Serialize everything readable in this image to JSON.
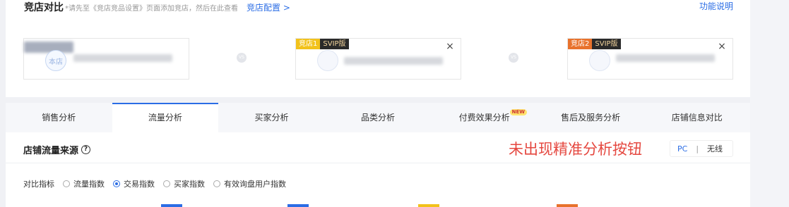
{
  "header": {
    "title": "竞店对比",
    "hint": "*请先至《竞店竞品设置》页面添加竞店，然后在此查看",
    "config_link": "竞店配置 >",
    "help_link": "功能说明"
  },
  "shops": [
    {
      "avatar_text": "本店"
    },
    {
      "badge": "竞店1",
      "badge_tier": "SVIP版",
      "badge_color": "#f2c21b",
      "close": "×"
    },
    {
      "badge": "竞店2",
      "badge_tier": "SVIP版",
      "badge_color": "#e8722c",
      "close": "×"
    }
  ],
  "vs_label": "VS",
  "tabs": [
    {
      "label": "销售分析"
    },
    {
      "label": "流量分析",
      "active": true
    },
    {
      "label": "买家分析"
    },
    {
      "label": "品类分析"
    },
    {
      "label": "付费效果分析",
      "tag": "NEW"
    },
    {
      "label": "售后及服务分析"
    },
    {
      "label": "店铺信息对比"
    }
  ],
  "section": {
    "title": "店铺流量来源",
    "help_icon": "?",
    "annotation": "未出现精准分析按钮",
    "switch": {
      "pc": "PC",
      "sep": "|",
      "wireless": "无线"
    }
  },
  "metrics": {
    "label": "对比指标",
    "options": [
      "流量指数",
      "交易指数",
      "买家指数",
      "有效询盘用户指数"
    ],
    "selected_index": 1
  },
  "colors": {
    "accent": "#2b6de5",
    "annotation": "#e5473f",
    "shop1": "#f2c21b",
    "shop2": "#e8722c"
  }
}
